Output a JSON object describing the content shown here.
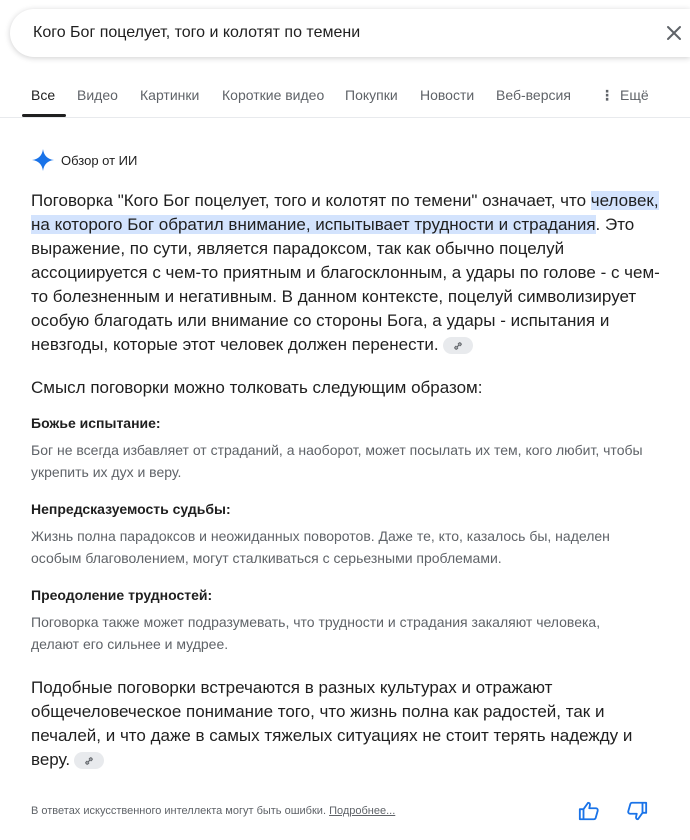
{
  "search": {
    "query": "Кого Бог поцелует, того и колотят по темени"
  },
  "tabs": [
    {
      "label": "Все"
    },
    {
      "label": "Видео"
    },
    {
      "label": "Картинки"
    },
    {
      "label": "Короткие видео"
    },
    {
      "label": "Покупки"
    },
    {
      "label": "Новости"
    },
    {
      "label": "Веб-версия"
    },
    {
      "label": "Ещё"
    }
  ],
  "ai_overview": {
    "title": "Обзор от ИИ",
    "para1_a": "Поговорка \"Кого Бог поцелует, того и колотят по темени\" означает, что ",
    "para1_highlight": "человек, на которого Бог обратил внимание, испытывает трудности и страдания",
    "para1_b": ". Это выражение, по сути, является парадоксом, так как обычно поцелуй ассоциируется с чем-то приятным и благосклонным, а удары по голове - с чем-то болезненным и негативным. В данном контексте, поцелуй символизирует особую благодать или внимание со стороны Бога, а удары - испытания и невзгоды, которые этот человек должен перенести.",
    "subheading": "Смысл поговорки можно толковать следующим образом:",
    "items": [
      {
        "title": "Божье испытание:",
        "text": "Бог не всегда избавляет от страданий, а наоборот, может посылать их тем, кого любит, чтобы укрепить их дух и веру."
      },
      {
        "title": "Непредсказуемость судьбы:",
        "text": "Жизнь полна парадоксов и неожиданных поворотов. Даже те, кто, казалось бы, наделен особым благоволением, могут сталкиваться с серьезными проблемами."
      },
      {
        "title": "Преодоление трудностей:",
        "text": "Поговорка также может подразумевать, что трудности и страдания закаляют человека, делают его сильнее и мудрее."
      }
    ],
    "para2": "Подобные поговорки встречаются в разных культурах и отражают общечеловеческое понимание того, что жизнь полна как радостей, так и печалей, и что даже в самых тяжелых ситуациях не стоит терять надежду и веру.",
    "disclaimer": "В ответах искусственного интеллекта могут быть ошибки.",
    "more_link": "Подробнее..."
  },
  "colors": {
    "highlight": "#d3e3fd",
    "sparkle": "#1a73e8",
    "secondary_text": "#5f6368"
  }
}
